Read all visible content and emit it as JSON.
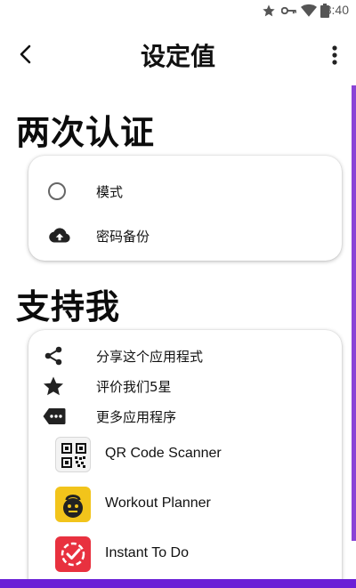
{
  "status_bar": {
    "time": "3:40",
    "icons": [
      "star-icon",
      "key-icon",
      "wifi-icon",
      "battery-icon"
    ]
  },
  "app_bar": {
    "title": "设定值",
    "back_icon": "arrow-back-icon",
    "more_icon": "more-vert-icon"
  },
  "sections": {
    "two_factor": {
      "heading": "两次认证",
      "items": [
        {
          "label": "模式",
          "icon": "radio-unchecked-icon"
        },
        {
          "label": "密码备份",
          "icon": "cloud-upload-icon"
        }
      ]
    },
    "support": {
      "heading": "支持我",
      "items": [
        {
          "label": "分享这个应用程式",
          "icon": "share-icon"
        },
        {
          "label": "评价我们5星",
          "icon": "star-icon"
        },
        {
          "label": "更多应用程序",
          "icon": "more-apps-icon"
        }
      ],
      "apps": [
        {
          "name": "QR Code Scanner",
          "icon": "qr-code-app-icon"
        },
        {
          "name": "Workout Planner",
          "icon": "kettlebell-app-icon"
        },
        {
          "name": "Instant To Do",
          "icon": "todo-check-app-icon"
        }
      ]
    }
  },
  "colors": {
    "accent": "#8a43d6",
    "bottom_bar": "#6a1fd6",
    "icon_dark": "#222222"
  }
}
